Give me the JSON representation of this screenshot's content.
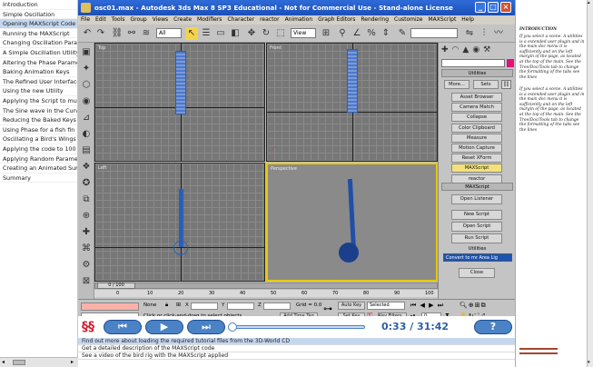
{
  "toc": {
    "items": [
      "Introduction",
      "Simple Oscillation",
      "Opening MAXScript Code",
      "Running the MAXScript",
      "Changing Oscillation Parameters",
      "A Simple Oscillation Utility",
      "Altering the Phase Parameters",
      "Baking Animation Keys",
      "The Refined User Interface",
      "Using the new Utility",
      "Applying the Script to multiple",
      "The Sine wave in the Curve",
      "Reducing the Baked Keys",
      "Using Phase for a fish fin",
      "Oscillating a Bird's Wings",
      "Applying the code to 100 Pd",
      "Applying Random Parameters",
      "Creating an Animated Surface",
      "Summary"
    ],
    "selected_index": 2
  },
  "max_window": {
    "title": "osc01.max - Autodesk 3ds Max 8 SP3 Educational - Not for Commercial Use - Stand-alone License",
    "menu": [
      "File",
      "Edit",
      "Tools",
      "Group",
      "Views",
      "Create",
      "Modifiers",
      "Character",
      "reactor",
      "Animation",
      "Graph Editors",
      "Rendering",
      "Customize",
      "MAXScript",
      "Help"
    ],
    "selection_filter": "All",
    "view_dropdown": "View",
    "viewports": {
      "top": "Top",
      "front": "Front",
      "left": "Left",
      "perspective": "Perspective"
    },
    "utilities_panel": {
      "rollout_title": "Utilities",
      "more_label": "More...",
      "sets_label": "Sets",
      "buttons": [
        "Asset Browser",
        "Camera Match",
        "Collapse",
        "Color Clipboard",
        "Measure",
        "Motion Capture",
        "Reset XForm",
        "MAXScript",
        "reactor"
      ],
      "highlight_index": 7,
      "maxscript_rollout_title": "MAXScript",
      "open_listener": "Open Listener",
      "new_script": "New Script",
      "open_script": "Open Script",
      "run_script": "Run Script",
      "utilities_label": "Utilities",
      "utility_select": "Convert to mr Area Lig",
      "close_label": "Close"
    },
    "time_slider": "0 / 100",
    "ruler_ticks": [
      "0",
      "10",
      "20",
      "30",
      "40",
      "50",
      "60",
      "70",
      "80",
      "90",
      "100"
    ],
    "status": {
      "selection": "None",
      "x_label": "X",
      "y_label": "Y",
      "z_label": "Z",
      "grid": "Grid = 0.0",
      "prompt": "Click or click-and-drag to select objects",
      "add_time_tag": "Add Time Tag",
      "auto_key": "Auto Key",
      "auto_key_sel": "Selected",
      "set_key": "Set Key",
      "key_filters": "Key Filters...",
      "frame": "0"
    }
  },
  "player": {
    "time": "0:33 / 31:42",
    "help_label": "?"
  },
  "tracks": [
    "Find out more about loading the required tutorial files from the 3D-World CD",
    "Get a detailed description of the MAXScript code",
    "See a video of the bird rig with the MAXScript applied"
  ],
  "right_panel": {
    "heading": "INTRODUCTION",
    "para1": "If you select a scene. A utilities is a extended user plugin and in the main doc menu it is sufficiently and on the left margin of the page, as located at the top of the main. See the Tree/Doc/Tools tab to change the formatting of the tabs see the lines",
    "para2": "If you select a scene. A utilities is a extended user plugin and in the main doc menu it is sufficiently and on the left margin of the page, as located at the top of the main. See the Tree/Doc/Tools tab to change the formatting of the tabs see the lines"
  },
  "colors": {
    "title_blue": "#1b4fb8",
    "selection": "#c5d7ef",
    "highlight": "#f3e27a",
    "player_blue": "#4b82c6",
    "viewport_active": "#e8c800",
    "object_blue": "#2a5fb8"
  }
}
